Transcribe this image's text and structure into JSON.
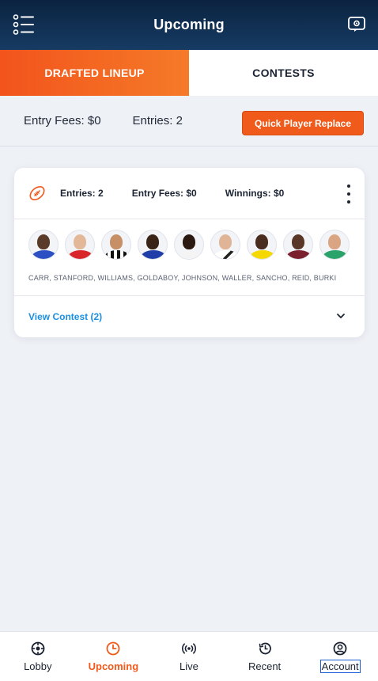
{
  "header": {
    "title": "Upcoming",
    "menu_icon": "menu-icon",
    "help_icon": "help-icon"
  },
  "tabs": [
    {
      "label": "DRAFTED LINEUP",
      "active": true
    },
    {
      "label": "CONTESTS",
      "active": false
    }
  ],
  "summary": {
    "entry_fees": "Entry Fees: $0",
    "entries": "Entries: 2",
    "quick_replace_label": "Quick Player Replace"
  },
  "card": {
    "sport_icon": "football-icon",
    "entries": "Entries: 2",
    "entry_fees": "Entry Fees: $0",
    "winnings": "Winnings: $0",
    "players": [
      "CARR",
      "STANFORD",
      "WILLIAMS",
      "GOLDABOY",
      "JOHNSON",
      "WALLER",
      "SANCHO",
      "REID",
      "BURKI"
    ],
    "player_names": "CARR, STANFORD, WILLIAMS, GOLDABOY, JOHNSON, WALLER, SANCHO, REID, BURKI",
    "view_contest": "View Contest (2)"
  },
  "bottom_nav": [
    {
      "label": "Lobby",
      "icon": "lobby-icon"
    },
    {
      "label": "Upcoming",
      "icon": "clock-icon",
      "active": true
    },
    {
      "label": "Live",
      "icon": "live-icon"
    },
    {
      "label": "Recent",
      "icon": "history-icon"
    },
    {
      "label": "Account",
      "icon": "account-icon"
    }
  ],
  "colors": {
    "accent": "#f05a1b",
    "link": "#1b8fe0",
    "header_dark": "#0b2340"
  }
}
